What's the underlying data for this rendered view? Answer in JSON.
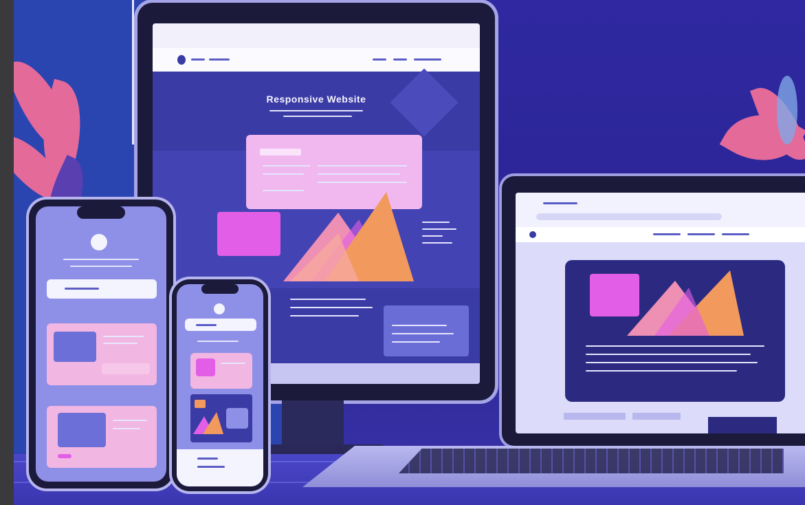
{
  "illustration": {
    "title": "Responsive Website",
    "colors": {
      "background": "#2a2490",
      "accent_pink": "#f0b8ee",
      "accent_magenta": "#e25ee6",
      "accent_orange": "#f29a5e",
      "device_frame": "#1b1a3a"
    }
  }
}
